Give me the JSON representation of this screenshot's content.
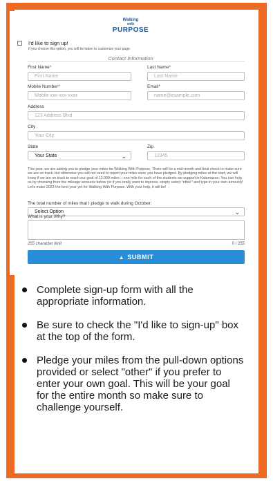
{
  "logo": {
    "line1": "Walking",
    "line2": "with",
    "line3": "PURPOSE"
  },
  "signup": {
    "label": "I'd like to sign up!",
    "note": "If you choose this option, you will be taken to customize your page."
  },
  "contact": {
    "title": "Contact Information",
    "first_name": {
      "label": "First Name",
      "placeholder": "First Name"
    },
    "last_name": {
      "label": "Last Name",
      "placeholder": "Last Name"
    },
    "mobile": {
      "label": "Mobile Number",
      "placeholder": "Mobile xxx-xxx-xxxx"
    },
    "email": {
      "label": "Email",
      "placeholder": "name@example.com"
    },
    "address": {
      "label": "Address",
      "placeholder": "123 Address Blvd"
    },
    "city": {
      "label": "City",
      "placeholder": "Your City"
    },
    "state": {
      "label": "State",
      "value": "Your State"
    },
    "zip": {
      "label": "Zip",
      "placeholder": "12345"
    },
    "required_mark": "*"
  },
  "pledge_text": "This year, we are asking you to pledge your miles for Walking With Purpose. There will be a mid-month and final check to make sure we are on track, but otherwise you will not need to report your miles were you have pledged. By pledging miles at the start, we will know if we are on track to reach our goal of 12,000 miles – one mile for each of the students we support in Kalamazoo. You can help us by choosing from the mileage amounts below (or if you really want to impress, simply select \"other\" and type in your own amount)! Let's make 2023 the best year yet for Walking With Purpose. With your help, it will be!",
  "pledge": {
    "label": "The total number of miles that I pledge to walk during October:",
    "value": "Select Option"
  },
  "why": {
    "label": "What is your Why?",
    "limit": "255 character limit",
    "counter": "0 / 255"
  },
  "submit": {
    "label": "SUBMIT"
  },
  "instructions": [
    "Complete sign-up form with all the appropriate information.",
    "Be sure to check the \"I'd like to sign-up\" box at the top of the form.",
    "Pledge your miles from the pull-down options provided or select \"other\" if you prefer to enter your own goal. This will be your goal for the entire month so make sure to challenge yourself."
  ],
  "colors": {
    "frame": "#ee6a22",
    "brand": "#1a54a6",
    "submit": "#2a8dd8"
  }
}
